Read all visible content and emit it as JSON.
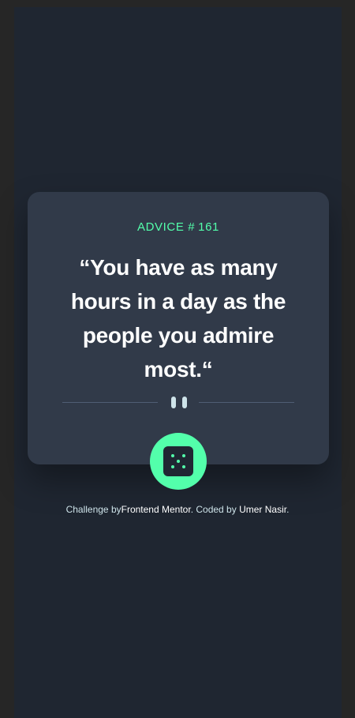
{
  "advice": {
    "label": "ADVICE #",
    "number": "161",
    "quote": "“You have as many hours in a day as the people you admire most.“"
  },
  "dice_button": {
    "icon": "dice-icon"
  },
  "footer": {
    "prefix": "Challenge by",
    "frontend_mentor": "Frontend Mentor",
    "coded_by": ". Coded by ",
    "author": "Umer Nasir",
    "suffix": "."
  },
  "colors": {
    "background": "#1f2631",
    "card": "#313a49",
    "accent": "#53ffab",
    "text": "#ffffff"
  }
}
